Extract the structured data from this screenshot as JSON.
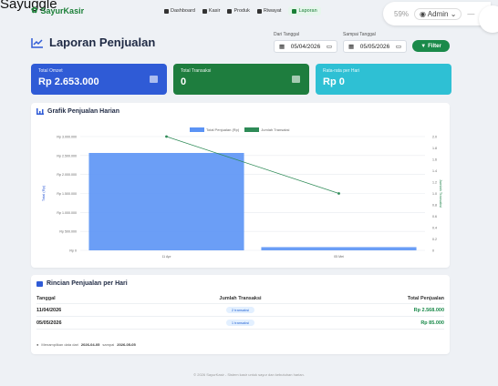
{
  "window_title": "Sayuggle",
  "brand": {
    "name": "SayurKasir",
    "icon": "leaf-icon"
  },
  "nav": [
    {
      "label": "Dashboard",
      "active": false
    },
    {
      "label": "Kasir",
      "active": false
    },
    {
      "label": "Produk",
      "active": false
    },
    {
      "label": "Riwayat",
      "active": false
    },
    {
      "label": "Laporan",
      "active": true
    }
  ],
  "browser": {
    "zoom": "59%",
    "user": "Admin"
  },
  "page": {
    "title": "Laporan Penjualan"
  },
  "filter": {
    "from_label": "Dari Tanggal",
    "from_value": "05/04/2026",
    "to_label": "Sampai Tanggal",
    "to_value": "05/05/2026",
    "button_label": "Filter"
  },
  "stats": {
    "total_omzet_label": "Total Omzet",
    "total_omzet_value": "Rp 2.653.000",
    "total_transaksi_label": "Total Transaksi",
    "total_transaksi_value": "0",
    "rata_rata_label": "Rata-rata per Hari",
    "rata_rata_value": "Rp 0"
  },
  "chart": {
    "title": "Grafik Penjualan Harian",
    "ylabel_left": "Total (Rp)",
    "ylabel_right": "Jumlah Transaksi"
  },
  "chart_data": {
    "type": "bar",
    "categories": [
      "11 Apr",
      "05 Mei"
    ],
    "series": [
      {
        "name": "Total Penjualan (Rp)",
        "type": "bar",
        "axis": "left",
        "values": [
          2568000,
          85000
        ],
        "color": "#5b93f5"
      },
      {
        "name": "Jumlah Transaksi",
        "type": "line",
        "axis": "right",
        "values": [
          2,
          1
        ],
        "color": "#2e8b57"
      }
    ],
    "y_left": {
      "min": 0,
      "max": 3000000,
      "ticks": [
        "Rp 0",
        "Rp 500.000",
        "Rp 1.000.000",
        "Rp 1.500.000",
        "Rp 2.000.000",
        "Rp 2.500.000",
        "Rp 3.000.000"
      ]
    },
    "y_right": {
      "min": 0,
      "max": 2,
      "ticks": [
        "0",
        "0.2",
        "0.4",
        "0.6",
        "0.8",
        "1.0",
        "1.2",
        "1.4",
        "1.6",
        "1.8",
        "2.0"
      ]
    },
    "grid": true,
    "legend": "top-center"
  },
  "table": {
    "title": "Rincian Penjualan per Hari",
    "headers": [
      "Tanggal",
      "Jumlah Transaksi",
      "Total Penjualan"
    ],
    "rows": [
      {
        "date": "11/04/2026",
        "count": "2 transaksi",
        "total": "Rp 2.568.000"
      },
      {
        "date": "05/05/2026",
        "count": "1 transaksi",
        "total": "Rp 85.000"
      }
    ],
    "note_prefix": "Menampilkan data dari",
    "note_from": "2026-04-05",
    "note_mid": "sampai",
    "note_to": "2026-05-05"
  },
  "footer": "© 2026 SayurKasir - Sistem kasir untuk sayur dan kebutuhan harian.",
  "colors": {
    "brand": "#1a7f37",
    "blue": "#2f5bd6",
    "green": "#1e7d3e",
    "cyan": "#2ec0d4"
  }
}
